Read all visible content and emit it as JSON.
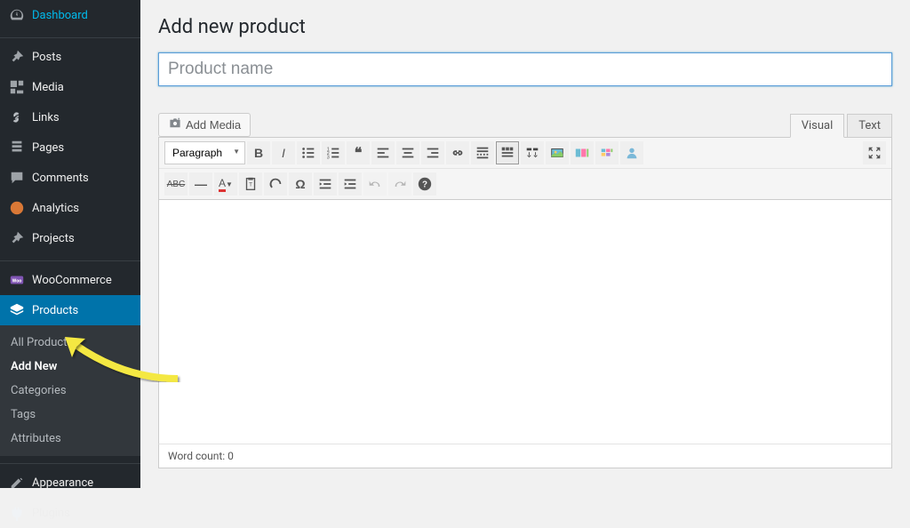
{
  "sidebar": {
    "items": [
      {
        "label": "Dashboard",
        "icon": "dashboard",
        "active": false
      },
      {
        "label": "Posts",
        "icon": "pin",
        "active": false
      },
      {
        "label": "Media",
        "icon": "media",
        "active": false
      },
      {
        "label": "Links",
        "icon": "link",
        "active": false
      },
      {
        "label": "Pages",
        "icon": "page",
        "active": false
      },
      {
        "label": "Comments",
        "icon": "comment",
        "active": false
      },
      {
        "label": "Analytics",
        "icon": "analytics",
        "active": false
      },
      {
        "label": "Projects",
        "icon": "pin",
        "active": false
      },
      {
        "label": "WooCommerce",
        "icon": "woocommerce",
        "active": false
      },
      {
        "label": "Products",
        "icon": "products",
        "active": true
      },
      {
        "label": "Appearance",
        "icon": "appearance",
        "active": false
      },
      {
        "label": "Plugins",
        "icon": "plugins",
        "active": false
      }
    ],
    "submenu": [
      {
        "label": "All Products",
        "active": false
      },
      {
        "label": "Add New",
        "active": true
      },
      {
        "label": "Categories",
        "active": false
      },
      {
        "label": "Tags",
        "active": false
      },
      {
        "label": "Attributes",
        "active": false
      }
    ]
  },
  "page": {
    "title": "Add new product",
    "title_placeholder": "Product name",
    "title_value": ""
  },
  "editor": {
    "add_media_label": "Add Media",
    "tabs": {
      "visual": "Visual",
      "html": "Text"
    },
    "format_select": "Paragraph",
    "word_count_label": "Word count: 0"
  }
}
